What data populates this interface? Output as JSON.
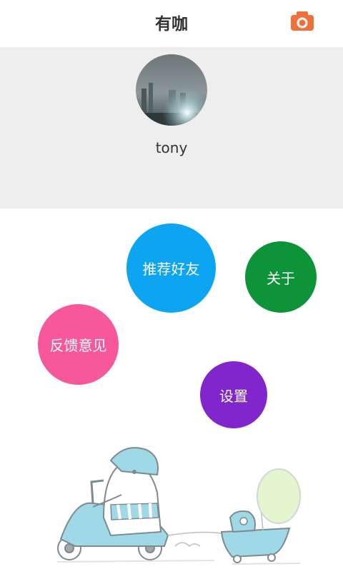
{
  "header": {
    "title": "有咖",
    "camera_icon": "camera-icon"
  },
  "profile": {
    "username": "tony",
    "avatar": "avatar-photo"
  },
  "menu": {
    "recommend_label": "推荐好友",
    "about_label": "关于",
    "feedback_label": "反馈意见",
    "settings_label": "设置"
  },
  "colors": {
    "recommend": "#0da5f2",
    "about": "#0d9438",
    "feedback": "#f7589c",
    "settings": "#8126cc",
    "camera": "#f0703a",
    "profile_bg": "#eeeeee"
  },
  "illustration": "scooter-character-illustration"
}
